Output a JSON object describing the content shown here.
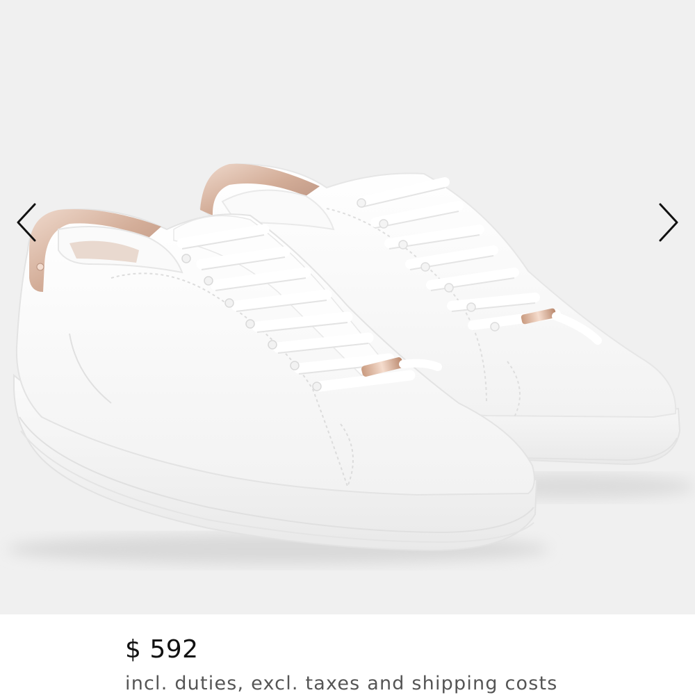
{
  "gallery": {
    "image": {
      "description_icon": "product-image",
      "background_color": "#f0f0f0",
      "accent_color": "#d9b8a6"
    },
    "prev_icon": "chevron-left-icon",
    "next_icon": "chevron-right-icon"
  },
  "product": {
    "price": "$ 592",
    "price_note": "incl. duties, excl. taxes and shipping costs"
  }
}
